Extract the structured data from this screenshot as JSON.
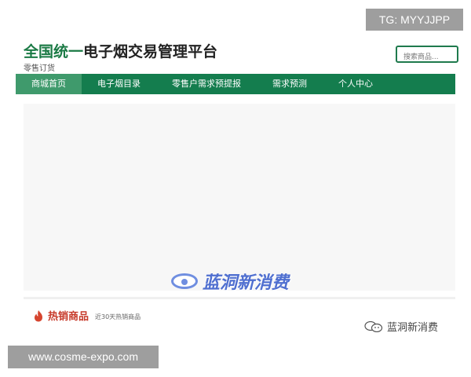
{
  "watermarks": {
    "telegram": "TG: MYYJJPP",
    "website": "www.cosme-expo.com",
    "center_logo_text": "蓝洞新消费",
    "wechat_account": "蓝洞新消费"
  },
  "header": {
    "title_accent": "全国统一",
    "title_rest": "电子烟交易管理平台",
    "subtitle": "零售订货",
    "accent_color": "#1b7a45"
  },
  "search": {
    "placeholder": "搜索商品..."
  },
  "nav": {
    "color": "#147d4e",
    "items": [
      {
        "label": "商城首页",
        "active": true
      },
      {
        "label": "电子烟目录"
      },
      {
        "label": "零售户需求预提报"
      },
      {
        "label": "需求预测"
      },
      {
        "label": "个人中心"
      }
    ]
  },
  "hot_section": {
    "icon": "flame-icon",
    "title": "热销商品",
    "subtitle": "近30天热销商品"
  }
}
